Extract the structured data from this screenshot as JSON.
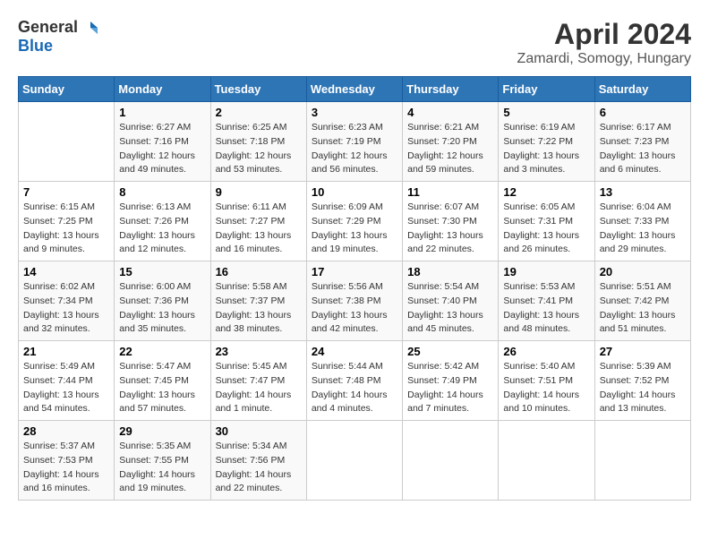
{
  "header": {
    "logo_line1": "General",
    "logo_line2": "Blue",
    "month": "April 2024",
    "location": "Zamardi, Somogy, Hungary"
  },
  "weekdays": [
    "Sunday",
    "Monday",
    "Tuesday",
    "Wednesday",
    "Thursday",
    "Friday",
    "Saturday"
  ],
  "weeks": [
    [
      {
        "day": "",
        "info": ""
      },
      {
        "day": "1",
        "info": "Sunrise: 6:27 AM\nSunset: 7:16 PM\nDaylight: 12 hours\nand 49 minutes."
      },
      {
        "day": "2",
        "info": "Sunrise: 6:25 AM\nSunset: 7:18 PM\nDaylight: 12 hours\nand 53 minutes."
      },
      {
        "day": "3",
        "info": "Sunrise: 6:23 AM\nSunset: 7:19 PM\nDaylight: 12 hours\nand 56 minutes."
      },
      {
        "day": "4",
        "info": "Sunrise: 6:21 AM\nSunset: 7:20 PM\nDaylight: 12 hours\nand 59 minutes."
      },
      {
        "day": "5",
        "info": "Sunrise: 6:19 AM\nSunset: 7:22 PM\nDaylight: 13 hours\nand 3 minutes."
      },
      {
        "day": "6",
        "info": "Sunrise: 6:17 AM\nSunset: 7:23 PM\nDaylight: 13 hours\nand 6 minutes."
      }
    ],
    [
      {
        "day": "7",
        "info": "Sunrise: 6:15 AM\nSunset: 7:25 PM\nDaylight: 13 hours\nand 9 minutes."
      },
      {
        "day": "8",
        "info": "Sunrise: 6:13 AM\nSunset: 7:26 PM\nDaylight: 13 hours\nand 12 minutes."
      },
      {
        "day": "9",
        "info": "Sunrise: 6:11 AM\nSunset: 7:27 PM\nDaylight: 13 hours\nand 16 minutes."
      },
      {
        "day": "10",
        "info": "Sunrise: 6:09 AM\nSunset: 7:29 PM\nDaylight: 13 hours\nand 19 minutes."
      },
      {
        "day": "11",
        "info": "Sunrise: 6:07 AM\nSunset: 7:30 PM\nDaylight: 13 hours\nand 22 minutes."
      },
      {
        "day": "12",
        "info": "Sunrise: 6:05 AM\nSunset: 7:31 PM\nDaylight: 13 hours\nand 26 minutes."
      },
      {
        "day": "13",
        "info": "Sunrise: 6:04 AM\nSunset: 7:33 PM\nDaylight: 13 hours\nand 29 minutes."
      }
    ],
    [
      {
        "day": "14",
        "info": "Sunrise: 6:02 AM\nSunset: 7:34 PM\nDaylight: 13 hours\nand 32 minutes."
      },
      {
        "day": "15",
        "info": "Sunrise: 6:00 AM\nSunset: 7:36 PM\nDaylight: 13 hours\nand 35 minutes."
      },
      {
        "day": "16",
        "info": "Sunrise: 5:58 AM\nSunset: 7:37 PM\nDaylight: 13 hours\nand 38 minutes."
      },
      {
        "day": "17",
        "info": "Sunrise: 5:56 AM\nSunset: 7:38 PM\nDaylight: 13 hours\nand 42 minutes."
      },
      {
        "day": "18",
        "info": "Sunrise: 5:54 AM\nSunset: 7:40 PM\nDaylight: 13 hours\nand 45 minutes."
      },
      {
        "day": "19",
        "info": "Sunrise: 5:53 AM\nSunset: 7:41 PM\nDaylight: 13 hours\nand 48 minutes."
      },
      {
        "day": "20",
        "info": "Sunrise: 5:51 AM\nSunset: 7:42 PM\nDaylight: 13 hours\nand 51 minutes."
      }
    ],
    [
      {
        "day": "21",
        "info": "Sunrise: 5:49 AM\nSunset: 7:44 PM\nDaylight: 13 hours\nand 54 minutes."
      },
      {
        "day": "22",
        "info": "Sunrise: 5:47 AM\nSunset: 7:45 PM\nDaylight: 13 hours\nand 57 minutes."
      },
      {
        "day": "23",
        "info": "Sunrise: 5:45 AM\nSunset: 7:47 PM\nDaylight: 14 hours\nand 1 minute."
      },
      {
        "day": "24",
        "info": "Sunrise: 5:44 AM\nSunset: 7:48 PM\nDaylight: 14 hours\nand 4 minutes."
      },
      {
        "day": "25",
        "info": "Sunrise: 5:42 AM\nSunset: 7:49 PM\nDaylight: 14 hours\nand 7 minutes."
      },
      {
        "day": "26",
        "info": "Sunrise: 5:40 AM\nSunset: 7:51 PM\nDaylight: 14 hours\nand 10 minutes."
      },
      {
        "day": "27",
        "info": "Sunrise: 5:39 AM\nSunset: 7:52 PM\nDaylight: 14 hours\nand 13 minutes."
      }
    ],
    [
      {
        "day": "28",
        "info": "Sunrise: 5:37 AM\nSunset: 7:53 PM\nDaylight: 14 hours\nand 16 minutes."
      },
      {
        "day": "29",
        "info": "Sunrise: 5:35 AM\nSunset: 7:55 PM\nDaylight: 14 hours\nand 19 minutes."
      },
      {
        "day": "30",
        "info": "Sunrise: 5:34 AM\nSunset: 7:56 PM\nDaylight: 14 hours\nand 22 minutes."
      },
      {
        "day": "",
        "info": ""
      },
      {
        "day": "",
        "info": ""
      },
      {
        "day": "",
        "info": ""
      },
      {
        "day": "",
        "info": ""
      }
    ]
  ]
}
